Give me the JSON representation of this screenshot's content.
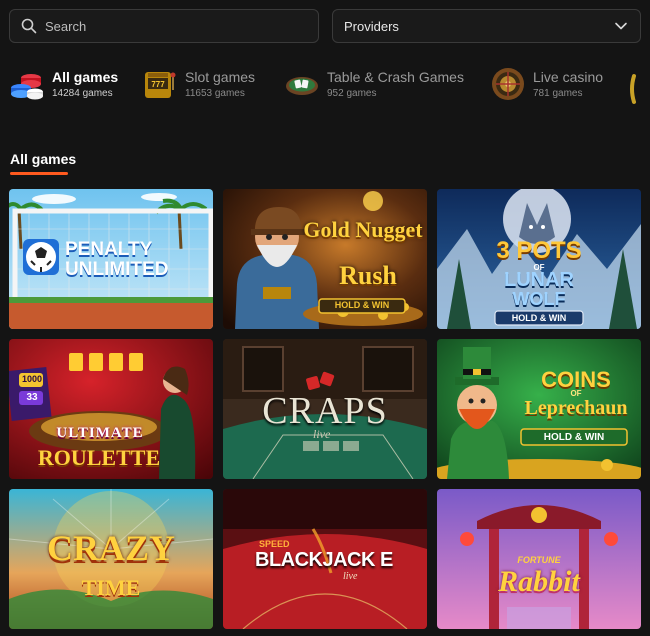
{
  "search": {
    "placeholder": "Search"
  },
  "providers": {
    "label": "Providers"
  },
  "categories": [
    {
      "name": "All games",
      "count": "14284 games",
      "icon": "casino-chips-icon",
      "active": true
    },
    {
      "name": "Slot games",
      "count": "11653 games",
      "icon": "slot-machine-icon",
      "active": false
    },
    {
      "name": "Table & Crash Games",
      "count": "952 games",
      "icon": "poker-table-icon",
      "active": false
    },
    {
      "name": "Live casino",
      "count": "781 games",
      "icon": "roulette-wheel-icon",
      "active": false
    }
  ],
  "section": {
    "title": "All games"
  },
  "games": [
    {
      "title_line1": "PENALTY",
      "title_line2": "UNLIMITED"
    },
    {
      "title_line1": "Gold Nugget",
      "title_line2": "Rush",
      "badge": "HOLD & WIN"
    },
    {
      "title_line1": "3 POTS",
      "title_sub": "OF",
      "title_line2": "LUNAR",
      "title_line3": "WOLF",
      "badge": "HOLD & WIN"
    },
    {
      "title_line1": "ULTIMATE",
      "title_line2": "ROULETTE",
      "counter_top": "1000",
      "counter_bottom": "33"
    },
    {
      "title_line1": "CRAPS",
      "title_line2": "live"
    },
    {
      "title_line1": "COINS",
      "title_sub": "OF",
      "title_line2": "Leprechaun",
      "badge": "HOLD & WIN"
    },
    {
      "title_line1": "CRAZY",
      "title_line2": "TIME"
    },
    {
      "title_line1": "SPEED",
      "title_line2": "BLACKJACK E",
      "title_line3": "live"
    },
    {
      "title_line1": "FORTUNE",
      "title_line2": "Rabbit"
    }
  ],
  "colors": {
    "accent": "#ff5a1f",
    "background": "#141414"
  }
}
